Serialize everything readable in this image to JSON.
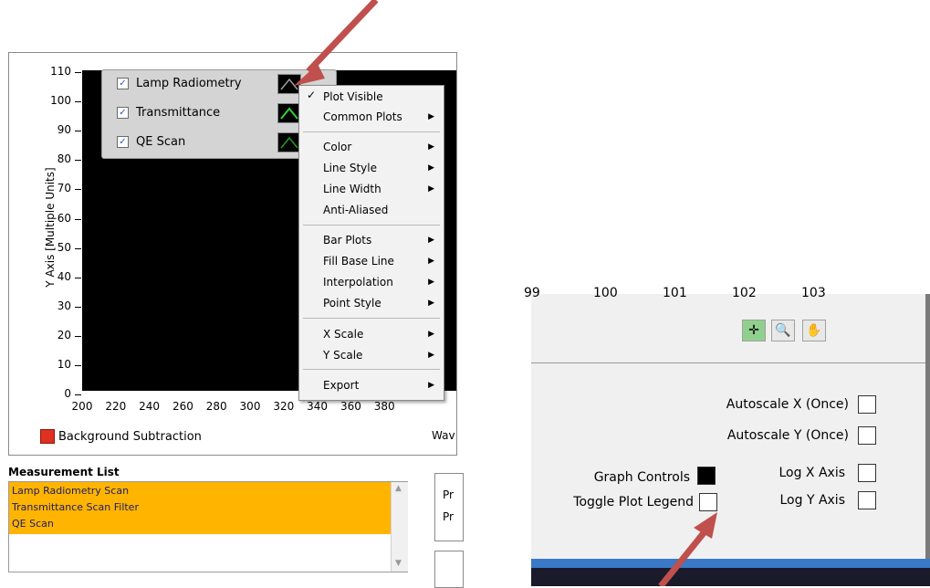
{
  "graph": {
    "y_axis_label": "Y Axis [Multiple Units]",
    "y_ticks": [
      "110",
      "100",
      "90",
      "80",
      "70",
      "60",
      "50",
      "40",
      "30",
      "20",
      "10",
      "0"
    ],
    "x_ticks": [
      "200",
      "220",
      "240",
      "260",
      "280",
      "300",
      "320",
      "340",
      "360",
      "380"
    ],
    "x_axis_label_partial": "Wav"
  },
  "legend": {
    "items": [
      {
        "label": "Lamp Radiometry",
        "checked": "✓",
        "color": "#a0a0a0"
      },
      {
        "label": "Transmittance",
        "checked": "✓",
        "color": "#30d030"
      },
      {
        "label": "QE Scan",
        "checked": "✓",
        "color": "#20a020"
      }
    ]
  },
  "context_menu": {
    "check_mark": "✓",
    "items": [
      {
        "label": "Plot Visible",
        "submenu": false
      },
      {
        "label": "Common Plots",
        "submenu": true
      },
      {
        "label": "Color",
        "submenu": true
      },
      {
        "label": "Line Style",
        "submenu": true
      },
      {
        "label": "Line Width",
        "submenu": true
      },
      {
        "label": "Anti-Aliased",
        "submenu": false
      },
      {
        "label": "Bar Plots",
        "submenu": true
      },
      {
        "label": "Fill Base Line",
        "submenu": true
      },
      {
        "label": "Interpolation",
        "submenu": true
      },
      {
        "label": "Point Style",
        "submenu": true
      },
      {
        "label": "X Scale",
        "submenu": true
      },
      {
        "label": "Y Scale",
        "submenu": true
      },
      {
        "label": "Export",
        "submenu": true
      }
    ]
  },
  "background_subtraction": {
    "label": "Background Subtraction"
  },
  "measurement_list": {
    "title": "Measurement List",
    "items": [
      "Lamp Radiometry Scan",
      "Transmittance Scan Filter",
      "QE Scan"
    ]
  },
  "partial_box": {
    "line1": "Pr",
    "line2": "Pr"
  },
  "right_panel": {
    "partial_ticks": [
      "99",
      "100",
      "101",
      "102",
      "103"
    ],
    "autoscale_x": "Autoscale X (Once)",
    "autoscale_y": "Autoscale Y (Once)",
    "graph_controls": "Graph Controls",
    "toggle_plot_legend": "Toggle Plot Legend",
    "log_x": "Log X Axis",
    "log_y": "Log Y Axis"
  },
  "colors": {
    "annotation_arrow": "#c0504d",
    "selection": "#ffb400",
    "plot_bg": "#000000"
  }
}
